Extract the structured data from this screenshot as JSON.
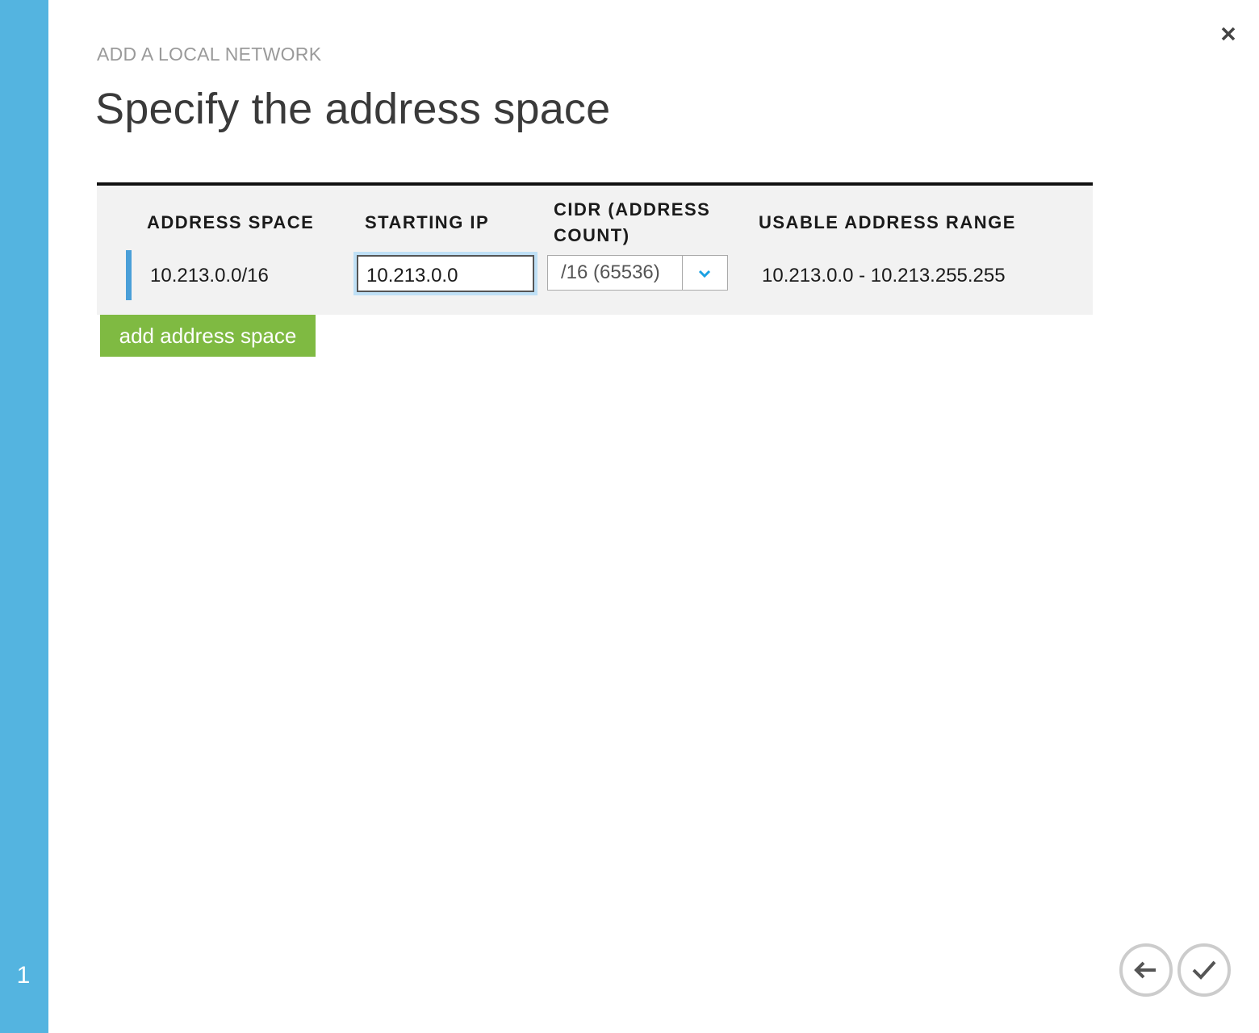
{
  "step_bar": {
    "step_number": "1"
  },
  "header": {
    "subtitle": "ADD A LOCAL NETWORK",
    "title": "Specify the address space"
  },
  "grid": {
    "columns": {
      "address_space": "ADDRESS SPACE",
      "starting_ip": "STARTING IP",
      "cidr_line1": "CIDR (ADDRESS",
      "cidr_line2": "COUNT)",
      "usable_range": "USABLE ADDRESS RANGE"
    },
    "rows": [
      {
        "address_space": "10.213.0.0/16",
        "starting_ip": "10.213.0.0",
        "cidr": "/16 (65536)",
        "usable_range": "10.213.0.0 - 10.213.255.255"
      }
    ]
  },
  "actions": {
    "add_label": "add address space"
  },
  "icons": {
    "close": "close-icon",
    "chevron": "chevron-down-icon",
    "back": "arrow-left-icon",
    "complete": "checkmark-icon"
  },
  "colors": {
    "step_bar": "#54b4e0",
    "accent_button": "#7fba42",
    "row_marker": "#4a9fd8",
    "chevron": "#1ba1e2"
  }
}
